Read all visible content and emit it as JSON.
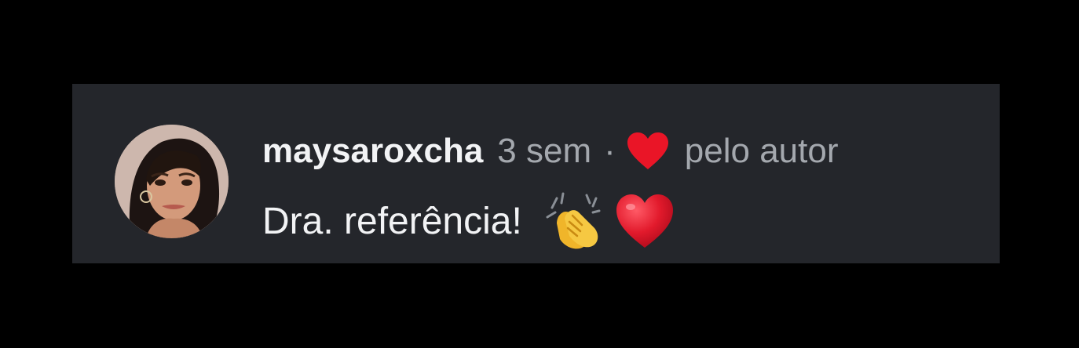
{
  "comment": {
    "username": "maysaroxcha",
    "timestamp": "3 sem",
    "separator": "·",
    "liked_by": "pelo autor",
    "body_text": "Dra. referência!",
    "emojis": [
      "clapping-hands-icon",
      "red-heart-icon"
    ]
  },
  "colors": {
    "background": "#000000",
    "card": "#24262b",
    "primary_text": "#f2f3f5",
    "secondary_text": "#a4a8ae",
    "like_red": "#ea1527"
  }
}
